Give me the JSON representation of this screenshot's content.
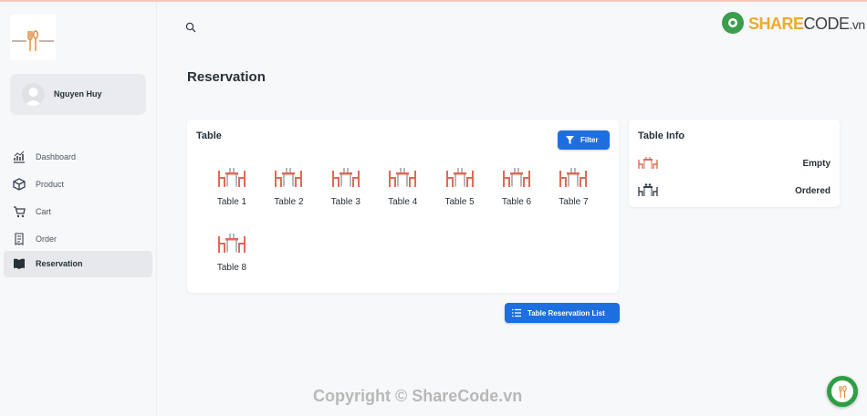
{
  "profile": {
    "name": "Nguyen Huy"
  },
  "nav": {
    "items": [
      {
        "label": "Dashboard",
        "icon": "chart-icon"
      },
      {
        "label": "Product",
        "icon": "box-icon"
      },
      {
        "label": "Cart",
        "icon": "cart-icon"
      },
      {
        "label": "Order",
        "icon": "receipt-icon"
      },
      {
        "label": "Reservation",
        "icon": "book-icon",
        "active": true
      }
    ]
  },
  "page": {
    "title": "Reservation"
  },
  "tables_card": {
    "title": "Table",
    "filter_label": "Filter",
    "tables": [
      "Table 1",
      "Table 2",
      "Table 3",
      "Table 4",
      "Table 5",
      "Table 6",
      "Table 7",
      "Table 8"
    ]
  },
  "info_card": {
    "title": "Table Info",
    "rows": [
      {
        "status": "Empty",
        "icon": "empty-table-icon"
      },
      {
        "status": "Ordered",
        "icon": "ordered-table-icon"
      }
    ]
  },
  "actions": {
    "list_label": "Table Reservation List"
  },
  "watermark": {
    "brand_a": "SHARE",
    "brand_b": "CODE",
    "brand_c": ".vn",
    "overlay": "ShareCode.vn"
  },
  "footer": {
    "copyright": "Copyright © ShareCode.vn"
  },
  "colors": {
    "accent": "#1d6fe0",
    "table_red": "#e06a55",
    "table_gray": "#6b7280"
  }
}
